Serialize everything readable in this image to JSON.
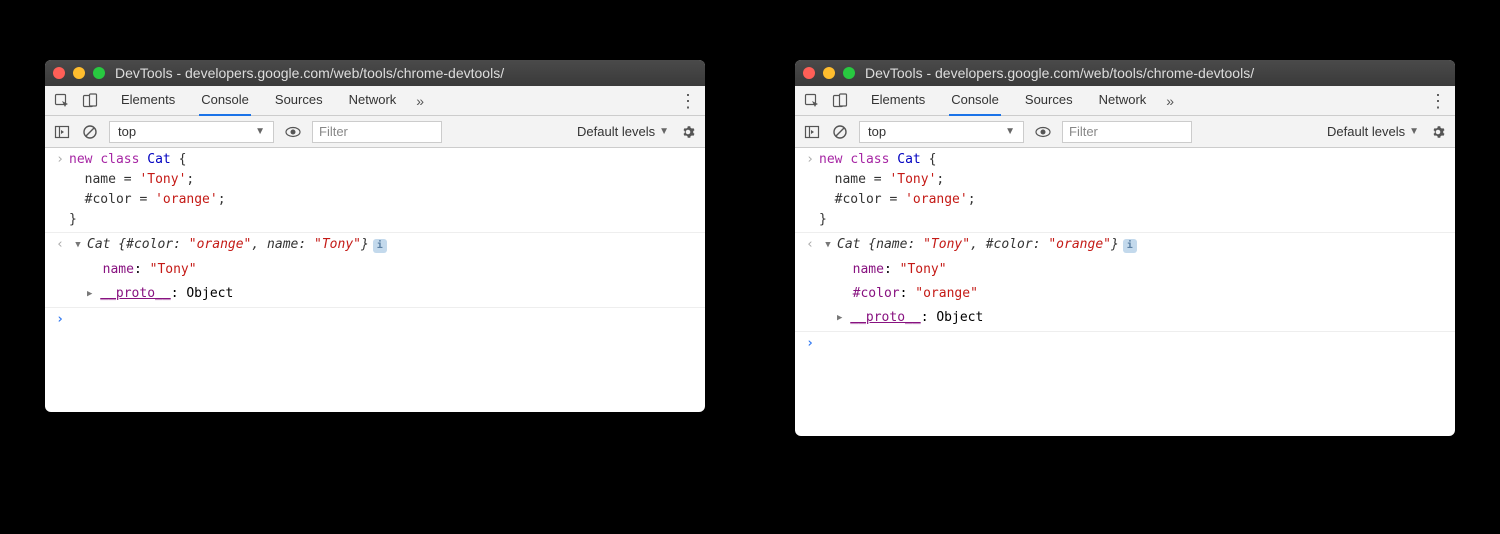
{
  "window_title": "DevTools - developers.google.com/web/tools/chrome-devtools/",
  "tabs": [
    "Elements",
    "Console",
    "Sources",
    "Network"
  ],
  "active_tab": "Console",
  "toolbar": {
    "context": "top",
    "filter_placeholder": "Filter",
    "levels_label": "Default levels"
  },
  "input_code": "new class Cat {\n  name = 'Tony';\n  #color = 'orange';\n}",
  "left": {
    "summary": "Cat {#color: \"orange\", name: \"Tony\"}",
    "summary_parts": {
      "class": "Cat",
      "p1k": "#color",
      "p1v": "\"orange\"",
      "p2k": "name",
      "p2v": "\"Tony\""
    },
    "props": [
      {
        "key": "name",
        "val": "\"Tony\""
      }
    ],
    "proto_label": "__proto__",
    "proto_val": "Object"
  },
  "right": {
    "summary": "Cat {name: \"Tony\", #color: \"orange\"}",
    "summary_parts": {
      "class": "Cat",
      "p1k": "name",
      "p1v": "\"Tony\"",
      "p2k": "#color",
      "p2v": "\"orange\""
    },
    "props": [
      {
        "key": "name",
        "val": "\"Tony\""
      },
      {
        "key": "#color",
        "val": "\"orange\""
      }
    ],
    "proto_label": "__proto__",
    "proto_val": "Object"
  }
}
